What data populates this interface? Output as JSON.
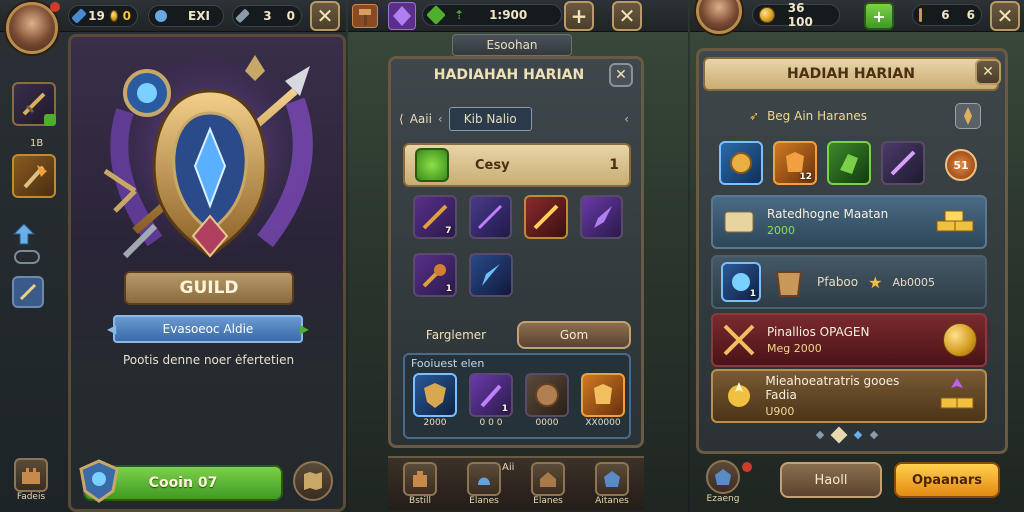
{
  "left": {
    "res_blue": "19",
    "res_gold": "0",
    "res_mid": "EXI",
    "res_right_a": "3",
    "res_right_b": "0",
    "side_label": "1B",
    "guild_title": "GUILD",
    "banner": "Evasoeoc Aldie",
    "subtitle": "Pootis denne noer ėfertetien",
    "main_button": "Cooin 07",
    "bottom_left_label": "Fadeis"
  },
  "middle": {
    "res_top_value": "1:900",
    "tab_label": "Esoohan",
    "title": "HADIAHAH HARIAN",
    "crumb_left": "Aaii",
    "crumb_box": "Kib Nalio",
    "featured_label": "Cesy",
    "featured_count": "1",
    "tab_a": "Farglemer",
    "tab_b": "Gom",
    "offer_label": "Fooiuest elen",
    "offer_prices": [
      "2000",
      "0 0 0",
      "0000",
      "XX0000"
    ],
    "item_levels_row1": [
      "7",
      "",
      "",
      ""
    ],
    "item_levels_row2": [
      "1",
      ""
    ],
    "offer_levels": [
      "",
      "1",
      "",
      ""
    ],
    "nav_labels": [
      "Bstill",
      "Elanes",
      "Elanes",
      "Aitanes"
    ],
    "nav_badge": "Aii"
  },
  "right": {
    "res_gold": "36 100",
    "res_a": "6",
    "res_b": "6",
    "title": "HADIAH HARIAN",
    "subheading": "Beg Ain Haranes",
    "top_levels": [
      "",
      "12",
      "",
      ""
    ],
    "badge": "51",
    "rows": [
      {
        "title": "Ratedhogne Maatan",
        "value": "2000",
        "level": ""
      },
      {
        "title": "Pfaboo",
        "value": "Ab0005",
        "level": "1"
      },
      {
        "title": "Pinallios OPAGEN",
        "value": "Meg 2000",
        "level": ""
      },
      {
        "title": "Mieahoeatratris gooes Fadia",
        "value": "U900",
        "level": ""
      }
    ],
    "btn_left": "Haoll",
    "btn_right": "Opaanars",
    "nav_label": "Ezaeng"
  },
  "colors": {
    "gold": "#e8b23a",
    "panel": "#2f383b",
    "green": "#4fae2c",
    "orange": "#f0a22a",
    "purple": "#6a3fa0",
    "blue": "#4a8ad0"
  }
}
